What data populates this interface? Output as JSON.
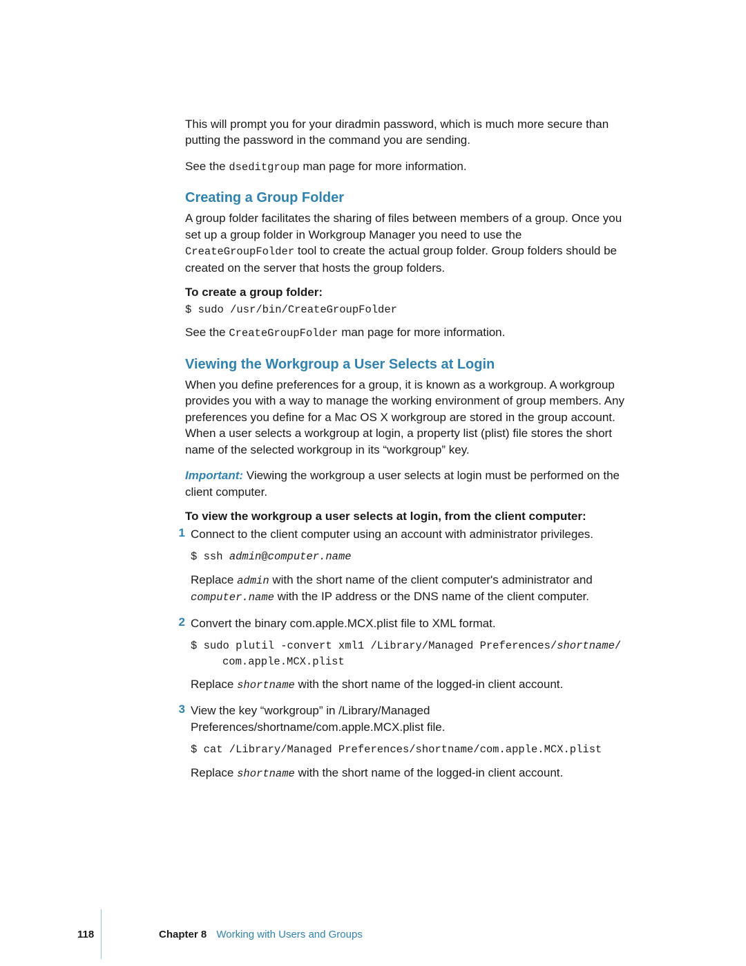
{
  "accentColor": "#2f82b0",
  "intro": {
    "p1": "This will prompt you for your diradmin password, which is much more secure than putting the password in the command you are sending.",
    "p2_pre": "See the ",
    "p2_code": "dseditgroup",
    "p2_post": " man page for more information."
  },
  "section1": {
    "heading": "Creating a Group Folder",
    "p1_pre": "A group folder facilitates the sharing of files between members of a group. Once you set up a group folder in Workgroup Manager you need to use the ",
    "p1_code": "CreateGroupFolder",
    "p1_post": " tool to create the actual group folder. Group folders should be created on the server that hosts the group folders.",
    "subhead": "To create a group folder:",
    "cmd": "$ sudo /usr/bin/CreateGroupFolder",
    "p2_pre": "See the ",
    "p2_code": "CreateGroupFolder",
    "p2_post": " man page for more information."
  },
  "section2": {
    "heading": "Viewing the Workgroup a User Selects at Login",
    "p1": "When you define preferences for a group, it is known as a workgroup. A workgroup provides you with a way to manage the working environment of group members. Any preferences you define for a Mac OS X workgroup are stored in the group account. When a user selects a workgroup at login, a property list (plist) file stores the short name of the selected workgroup in its “workgroup” key.",
    "important_label": "Important:  ",
    "important_text": "Viewing the workgroup a user selects at login must be performed on the client computer.",
    "subhead": "To view the workgroup a user selects at login, from the client computer:",
    "step1": {
      "num": "1",
      "text": "Connect to the client computer using an account with administrator privileges.",
      "cmd_pre": "$ ssh ",
      "cmd_admin": "admin",
      "cmd_at": "@",
      "cmd_host": "computer.name",
      "replace_pre": "Replace ",
      "replace_admin": "admin",
      "replace_mid": " with the short name of the client computer's administrator and ",
      "replace_host": "computer.name",
      "replace_post": " with the IP address or the DNS name of the client computer."
    },
    "step2": {
      "num": "2",
      "text": "Convert the binary com.apple.MCX.plist file to XML format.",
      "cmd_line1_pre": "$ sudo plutil -convert xml1 /Library/Managed Preferences/",
      "cmd_line1_var": "shortname",
      "cmd_line1_post": "/",
      "cmd_line2": "com.apple.MCX.plist",
      "replace_pre": "Replace ",
      "replace_var": "shortname",
      "replace_post": " with the short name of the logged-in client account."
    },
    "step3": {
      "num": "3",
      "text": "View the key “workgroup” in /Library/Managed Preferences/shortname/com.apple.MCX.plist file.",
      "cmd": "$ cat /Library/Managed Preferences/shortname/com.apple.MCX.plist",
      "replace_pre": "Replace ",
      "replace_var": "shortname",
      "replace_post": " with the short name of the logged-in client account."
    }
  },
  "footer": {
    "page": "118",
    "chapterLabel": "Chapter 8",
    "chapterTitle": "Working with Users and Groups"
  }
}
